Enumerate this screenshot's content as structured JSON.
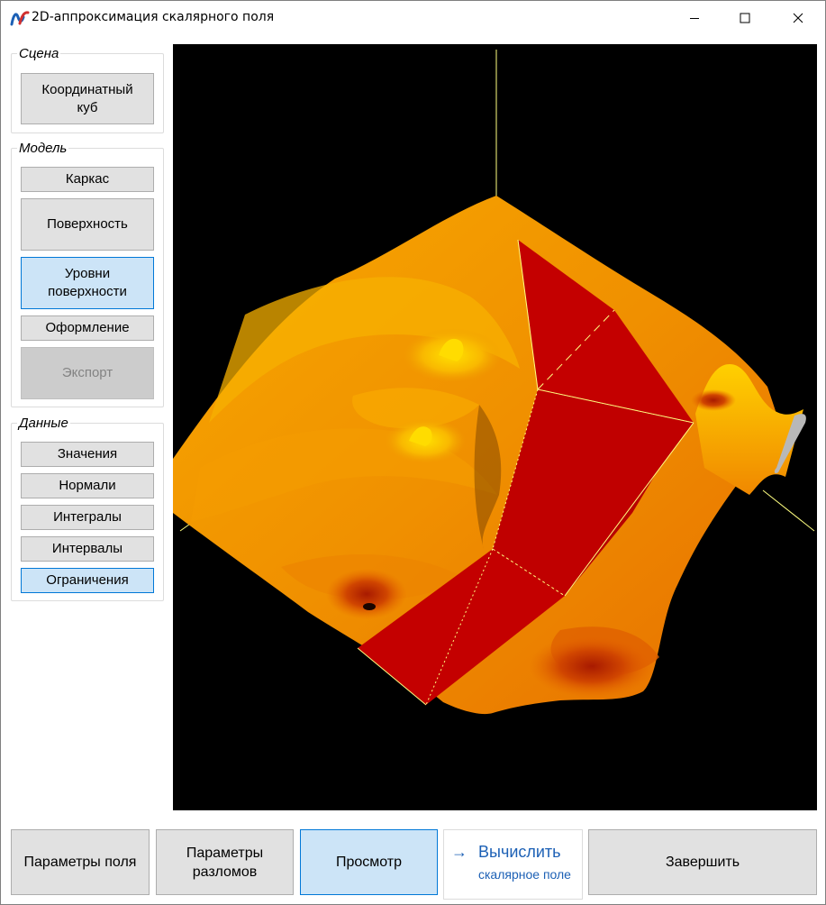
{
  "window": {
    "title": "2D-аппроксимация скалярного поля"
  },
  "titlebar_icons": {
    "app": "app-logo-icon",
    "minimize": "minimize-icon",
    "maximize": "maximize-icon",
    "close": "close-icon"
  },
  "groups": {
    "scene": {
      "title": "Сцена",
      "buttons": [
        {
          "label": "Координатный куб",
          "state": "normal"
        }
      ]
    },
    "model": {
      "title": "Модель",
      "buttons": [
        {
          "label": "Каркас",
          "state": "normal"
        },
        {
          "label": "Поверхность",
          "state": "normal"
        },
        {
          "label": "Уровни поверхности",
          "state": "active"
        },
        {
          "label": "Оформление",
          "state": "normal"
        },
        {
          "label": "Экспорт",
          "state": "disabled"
        }
      ]
    },
    "data": {
      "title": "Данные",
      "buttons": [
        {
          "label": "Значения",
          "state": "normal"
        },
        {
          "label": "Нормали",
          "state": "normal"
        },
        {
          "label": "Интегралы",
          "state": "normal"
        },
        {
          "label": "Интервалы",
          "state": "normal"
        },
        {
          "label": "Ограничения",
          "state": "active"
        }
      ]
    }
  },
  "bottom": {
    "field_params": "Параметры поля",
    "fault_params": "Параметры разломов",
    "preview": "Просмотр",
    "compute_main": "Вычислить",
    "compute_note": "скалярное поле",
    "finish": "Завершить"
  },
  "colors": {
    "viewport_bg": "#000000",
    "surface_orange": "#f08a00",
    "fault_red": "#c80000",
    "axis_yellow": "#ffff80",
    "active_blue": "#cce4f7",
    "link_blue": "#1c60b5"
  }
}
